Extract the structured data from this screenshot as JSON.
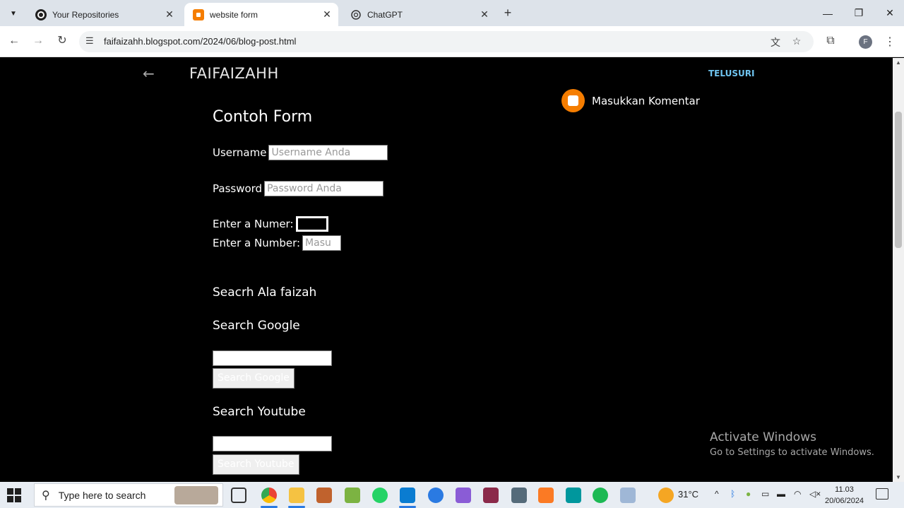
{
  "browser": {
    "tabs": [
      {
        "label": "Your Repositories",
        "icon": "github-icon"
      },
      {
        "label": "website form",
        "icon": "blogger-icon",
        "active": true
      },
      {
        "label": "ChatGPT",
        "icon": "chatgpt-icon"
      }
    ],
    "url": "faifaizahh.blogspot.com/2024/06/blog-post.html",
    "profile_initial": "F"
  },
  "page": {
    "site_title": "FAIFAIZAHH",
    "search_link": "TELUSURI",
    "comment_label": "Masukkan Komentar",
    "form_title": "Contoh Form",
    "username_label": "Username",
    "username_placeholder": "Username Anda",
    "password_label": "Password",
    "password_placeholder": "Password Anda",
    "numer_label": "Enter a Numer:",
    "number_label": "Enter a Number:",
    "number_placeholder": "Masu",
    "search_heading": "Seacrh Ala faizah",
    "google_heading": "Search Google",
    "google_button": "Search Google",
    "youtube_heading": "Search Youtube",
    "youtube_button": "Search Youtube"
  },
  "watermark": {
    "line1": "Activate Windows",
    "line2": "Go to Settings to activate Windows."
  },
  "taskbar": {
    "search_placeholder": "Type here to search",
    "weather": "31°C",
    "time": "11.03",
    "date": "20/06/2024"
  }
}
